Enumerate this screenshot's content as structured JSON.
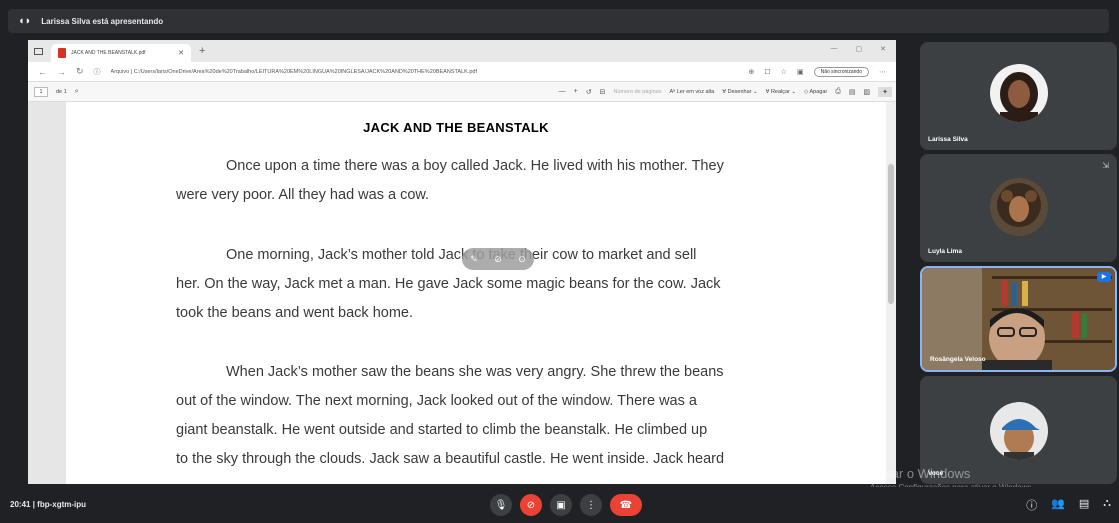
{
  "presenter": {
    "text": "Larissa Silva está apresentando"
  },
  "browser": {
    "tab_title": "JACK AND THE BEANSTALK.pdf",
    "url_prefix": "Arquivo",
    "url": "C:/Users/laris/OneDrive/Área%20de%20Trabalho/LEITURA%20EM%20LÍNGUA%20INGLESA/JACK%20AND%20THE%20BEANSTALK.pdf",
    "sync_label": "Não sincronizando"
  },
  "pdf_toolbar": {
    "page_number": "1",
    "page_total": "de 1",
    "page_view": "Número de páginas",
    "read_aloud": "Ler em voz alta",
    "draw": "Desenhar",
    "highlight": "Realçar",
    "erase": "Apagar"
  },
  "document": {
    "title": "JACK AND THE BEANSTALK",
    "p1": [
      "Once upon a time there was a boy called Jack. He lived with his mother. They",
      "were very poor. All they had was a cow."
    ],
    "p2": [
      "One morning, Jack’s mother told Jack to take their cow to market and sell",
      "her. On the way, Jack met a man. He gave Jack some magic beans for the cow. Jack",
      "took the beans and went back home."
    ],
    "p3": [
      "When Jack’s mother saw the beans she was very angry. She threw the beans",
      "out of the window. The next morning, Jack looked out of the window. There was a",
      "giant beanstalk. He went outside and started to climb the beanstalk. He climbed up",
      "to the sky through the clouds. Jack saw a beautiful castle. He went inside. Jack heard"
    ]
  },
  "participants": [
    {
      "name": "Larissa Silva"
    },
    {
      "name": "Luyla Lima"
    },
    {
      "name": "Rosângela Veloso"
    },
    {
      "name": "Você"
    }
  ],
  "bottom": {
    "time": "20:41",
    "meeting_code": "fbp-xgtm-ipu"
  },
  "watermark": {
    "line1": "Ativar o Windows",
    "line2": "Acesse Configurações para ativar o Windows."
  },
  "colors": {
    "end_call": "#ea4335",
    "active_border": "#8ab4f8",
    "pdf_icon": "#d93025"
  }
}
